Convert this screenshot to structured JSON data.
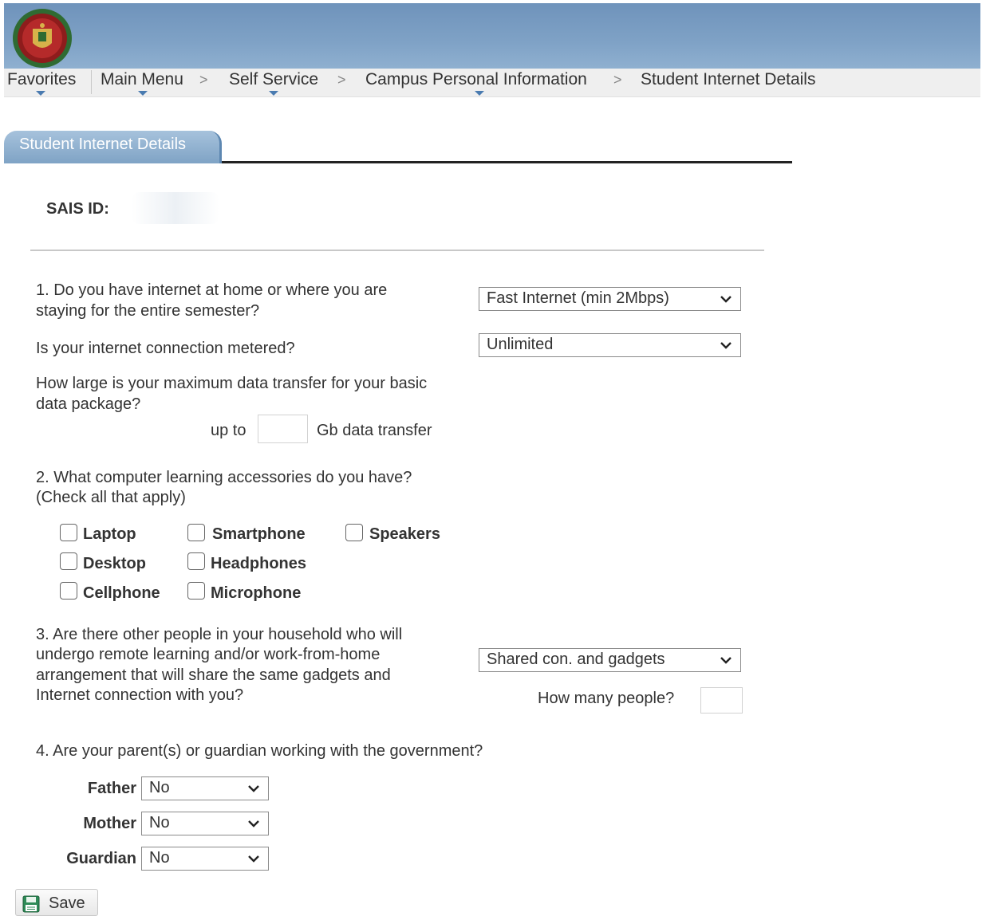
{
  "nav": {
    "favorites": "Favorites",
    "main_menu": "Main Menu",
    "self_service": "Self Service",
    "campus_personal_information": "Campus Personal Information",
    "current_page": "Student Internet Details",
    "separator": ">"
  },
  "tab": {
    "label": "Student Internet Details"
  },
  "sais": {
    "label": "SAIS ID:",
    "value": ""
  },
  "q1": {
    "text_line1": "1. Do you have internet at home or where you are",
    "text_line2": "staying for the entire semester?",
    "select_value": "Fast Internet (min 2Mbps)",
    "metered_question": "Is your internet connection metered?",
    "metered_value": "Unlimited",
    "data_question_line1": "How large is your maximum data transfer for your basic",
    "data_question_line2": "data package?",
    "up_to": "up to",
    "data_value": "",
    "gb_label": "Gb data transfer"
  },
  "q2": {
    "text_line1": "2. What computer learning accessories do you have?",
    "text_line2": "(Check all that apply)",
    "options": [
      {
        "label": "Laptop",
        "checked": false
      },
      {
        "label": "Smartphone",
        "checked": false
      },
      {
        "label": "Speakers",
        "checked": false
      },
      {
        "label": "Desktop",
        "checked": false
      },
      {
        "label": "Headphones",
        "checked": false
      },
      {
        "label": "Cellphone",
        "checked": false
      },
      {
        "label": "Microphone",
        "checked": false
      }
    ]
  },
  "q3": {
    "line1": "3. Are there other people in your household who will",
    "line2": "undergo remote learning and/or work-from-home",
    "line3": "arrangement that will share the same gadgets and",
    "line4": "Internet connection with you?",
    "select_value": "Shared con. and gadgets",
    "how_many_label": "How many people?",
    "how_many_value": ""
  },
  "q4": {
    "text": "4. Are your parent(s) or guardian working with the government?",
    "father_label": "Father",
    "father_value": "No",
    "mother_label": "Mother",
    "mother_value": "No",
    "guardian_label": "Guardian",
    "guardian_value": "No"
  },
  "save": {
    "label": "Save"
  },
  "colors": {
    "banner": "#7fa2c6",
    "navbar": "#efefef",
    "tab": "#8fb0d0",
    "nav_arrow": "#4a7bb0"
  },
  "icons": {
    "logo": "university-seal-icon",
    "save": "floppy-disk-icon",
    "dropdown": "chevron-down-icon"
  }
}
